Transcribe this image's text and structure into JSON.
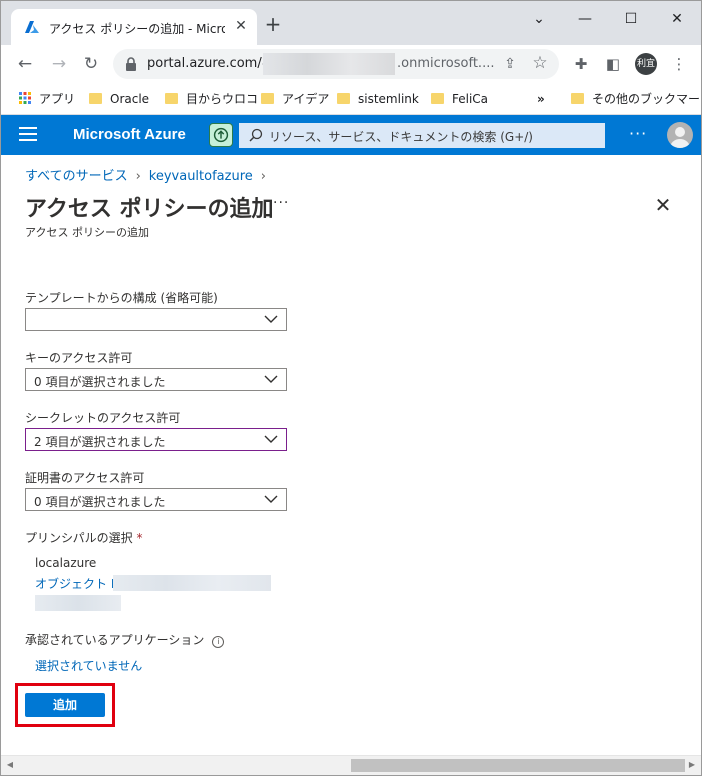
{
  "browser": {
    "tab_title": "アクセス ポリシーの追加 - Microsoft",
    "url_prefix": "portal.azure.com/#",
    "url_suffix": ".onmicrosoft....",
    "profile_label": "利宜",
    "bookmarks": [
      {
        "label": "アプリ",
        "icon": "apps-icon"
      },
      {
        "label": "Oracle",
        "icon": "folder-icon"
      },
      {
        "label": "目からウロコ",
        "icon": "folder-icon"
      },
      {
        "label": "アイデア",
        "icon": "folder-icon"
      },
      {
        "label": "sistemlink",
        "icon": "folder-icon"
      },
      {
        "label": "FeliCa",
        "icon": "folder-icon"
      },
      {
        "label": "その他のブックマーク",
        "icon": "folder-icon"
      }
    ]
  },
  "header": {
    "brand": "Microsoft Azure",
    "search_placeholder": "リソース、サービス、ドキュメントの検索 (G+/)",
    "accent": "#0078d4"
  },
  "breadcrumb": {
    "items": [
      "すべてのサービス",
      "keyvaultofazure"
    ]
  },
  "page": {
    "title": "アクセス ポリシーの追加",
    "subtitle": "アクセス ポリシーの追加"
  },
  "form": {
    "template": {
      "label": "テンプレートからの構成 (省略可能)",
      "value": ""
    },
    "key_permissions": {
      "label": "キーのアクセス許可",
      "value": "0 項目が選択されました"
    },
    "secret_permissions": {
      "label": "シークレットのアクセス許可",
      "value": "2 項目が選択されました"
    },
    "cert_permissions": {
      "label": "証明書のアクセス許可",
      "value": "0 項目が選択されました"
    },
    "principal": {
      "label": "プリンシパルの選択",
      "required_mark": "*",
      "name": "localazure",
      "object_id_label": "オブジェクト ID:"
    },
    "authorized_app": {
      "label": "承認されているアプリケーション",
      "value": "選択されていません"
    },
    "add_button": "追加",
    "highlight_color": "#e0000f"
  }
}
